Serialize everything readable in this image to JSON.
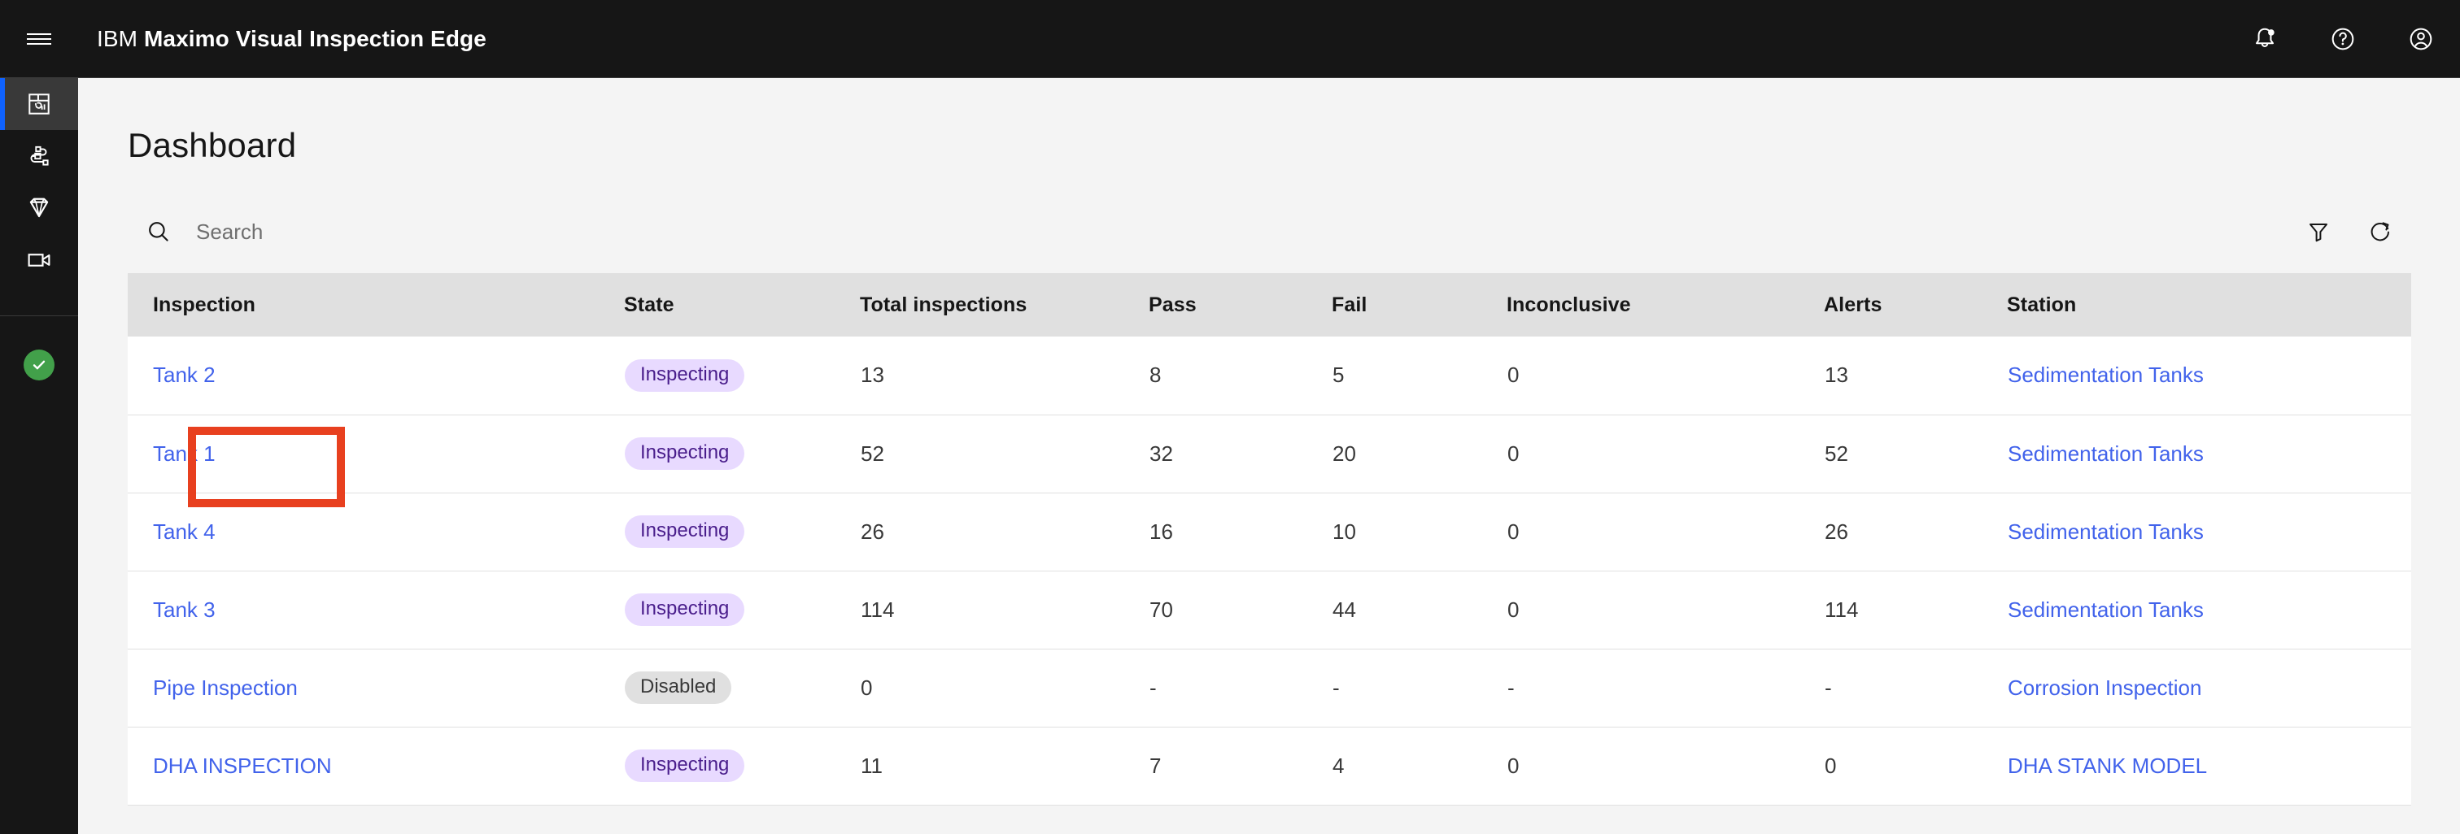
{
  "header": {
    "menu_icon": "hamburger-menu-icon",
    "brand_prefix": "IBM",
    "brand_name": "Maximo Visual Inspection Edge",
    "icons": [
      {
        "name": "notification-bell-icon",
        "label": "Notifications",
        "has_badge": true
      },
      {
        "name": "help-icon",
        "label": "Help"
      },
      {
        "name": "user-avatar-icon",
        "label": "Account"
      }
    ]
  },
  "sidebar": {
    "items": [
      {
        "name": "sidebar-item-dashboard",
        "icon": "dashboard-icon",
        "label": "Dashboard",
        "active": true
      },
      {
        "name": "sidebar-item-workflow",
        "icon": "workflow-nodes-icon",
        "label": "Workflows",
        "active": false
      },
      {
        "name": "sidebar-item-models",
        "icon": "diamond-icon",
        "label": "Models",
        "active": false
      },
      {
        "name": "sidebar-item-cameras",
        "icon": "video-camera-icon",
        "label": "Cameras",
        "active": false
      }
    ],
    "status": {
      "name": "system-status-indicator",
      "icon": "check-circle-icon",
      "color": "#42a04a"
    }
  },
  "page": {
    "title": "Dashboard"
  },
  "toolbar": {
    "search_icon": "search-icon",
    "search_placeholder": "Search",
    "search_value": "",
    "filter_icon": "filter-funnel-icon",
    "filter_label": "Filter",
    "refresh_icon": "refresh-icon",
    "refresh_label": "Refresh"
  },
  "colors": {
    "accent_blue": "#0f62fe",
    "link_blue": "#4263eb",
    "badge_inspecting_bg": "#e8daff",
    "badge_inspecting_text": "#491d8b",
    "badge_disabled_bg": "#e0e0e0",
    "badge_disabled_text": "#393939",
    "annotation_red": "#e8401f",
    "header_bar": "#161616",
    "table_header_bg": "#e0e0e0",
    "page_bg": "#f4f4f4",
    "status_green": "#42a04a"
  },
  "table": {
    "columns": [
      {
        "key": "inspection",
        "label": "Inspection"
      },
      {
        "key": "state",
        "label": "State"
      },
      {
        "key": "total",
        "label": "Total inspections"
      },
      {
        "key": "pass",
        "label": "Pass"
      },
      {
        "key": "fail",
        "label": "Fail"
      },
      {
        "key": "inconclusive",
        "label": "Inconclusive"
      },
      {
        "key": "alerts",
        "label": "Alerts"
      },
      {
        "key": "station",
        "label": "Station"
      }
    ],
    "rows": [
      {
        "inspection": "Tank 2",
        "state": "Inspecting",
        "state_kind": "inspecting",
        "total": "13",
        "pass": "8",
        "fail": "5",
        "inconclusive": "0",
        "alerts": "13",
        "station": "Sedimentation Tanks",
        "highlighted": false
      },
      {
        "inspection": "Tank 1",
        "state": "Inspecting",
        "state_kind": "inspecting",
        "total": "52",
        "pass": "32",
        "fail": "20",
        "inconclusive": "0",
        "alerts": "52",
        "station": "Sedimentation Tanks",
        "highlighted": true
      },
      {
        "inspection": "Tank 4",
        "state": "Inspecting",
        "state_kind": "inspecting",
        "total": "26",
        "pass": "16",
        "fail": "10",
        "inconclusive": "0",
        "alerts": "26",
        "station": "Sedimentation Tanks",
        "highlighted": false
      },
      {
        "inspection": "Tank 3",
        "state": "Inspecting",
        "state_kind": "inspecting",
        "total": "114",
        "pass": "70",
        "fail": "44",
        "inconclusive": "0",
        "alerts": "114",
        "station": "Sedimentation Tanks",
        "highlighted": false
      },
      {
        "inspection": "Pipe Inspection",
        "state": "Disabled",
        "state_kind": "disabled",
        "total": "0",
        "pass": "-",
        "fail": "-",
        "inconclusive": "-",
        "alerts": "-",
        "station": "Corrosion Inspection",
        "highlighted": false
      },
      {
        "inspection": "DHA INSPECTION",
        "state": "Inspecting",
        "state_kind": "inspecting",
        "total": "11",
        "pass": "7",
        "fail": "4",
        "inconclusive": "0",
        "alerts": "0",
        "station": "DHA STANK MODEL",
        "highlighted": false
      }
    ]
  }
}
